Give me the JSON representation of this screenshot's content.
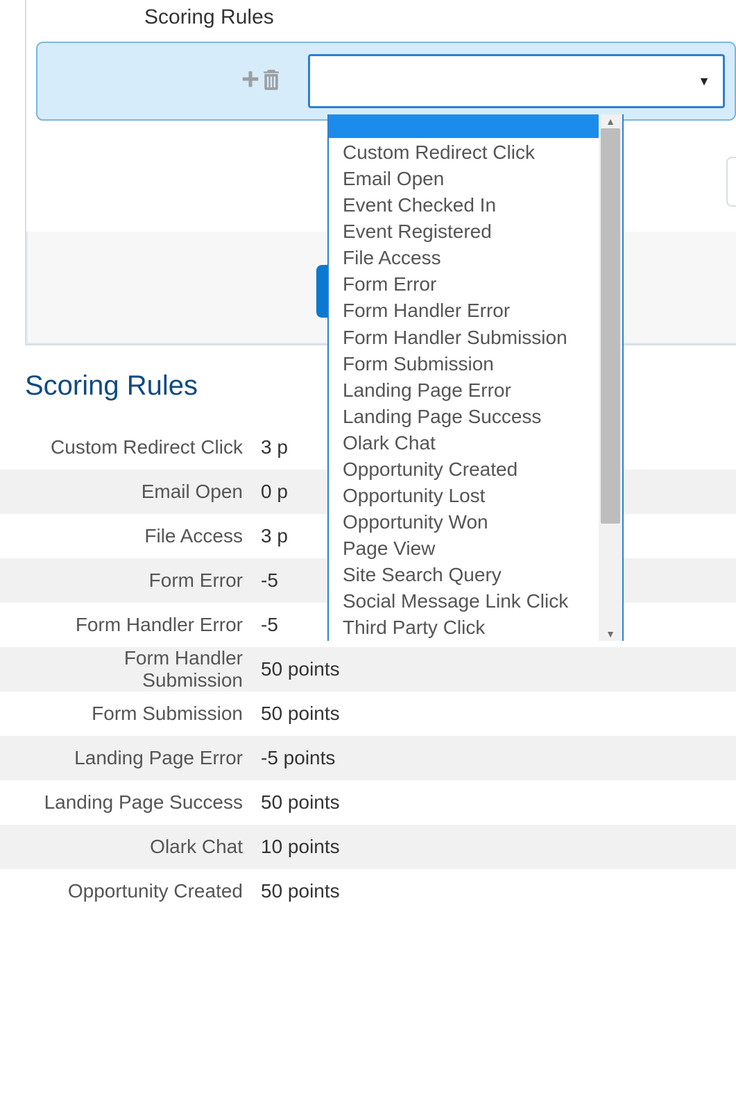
{
  "panel": {
    "title": "Scoring Rules",
    "select_caret": "▼"
  },
  "dropdown": {
    "options": [
      "Custom Redirect Click",
      "Email Open",
      "Event Checked In",
      "Event Registered",
      "File Access",
      "Form Error",
      "Form Handler Error",
      "Form Handler Submission",
      "Form Submission",
      "Landing Page Error",
      "Landing Page Success",
      "Olark Chat",
      "Opportunity Created",
      "Opportunity Lost",
      "Opportunity Won",
      "Page View",
      "Site Search Query",
      "Social Message Link Click",
      "Third Party Click"
    ]
  },
  "section": {
    "heading": "Scoring Rules"
  },
  "rules": [
    {
      "label": "Custom Redirect Click",
      "value": "3 p"
    },
    {
      "label": "Email Open",
      "value": "0 p"
    },
    {
      "label": "File Access",
      "value": "3 p"
    },
    {
      "label": "Form Error",
      "value": "-5 "
    },
    {
      "label": "Form Handler Error",
      "value": "-5 "
    },
    {
      "label": "Form Handler Submission",
      "value": "50 points"
    },
    {
      "label": "Form Submission",
      "value": "50 points"
    },
    {
      "label": "Landing Page Error",
      "value": "-5 points"
    },
    {
      "label": "Landing Page Success",
      "value": "50 points"
    },
    {
      "label": "Olark Chat",
      "value": "10 points"
    },
    {
      "label": "Opportunity Created",
      "value": "50 points"
    }
  ]
}
